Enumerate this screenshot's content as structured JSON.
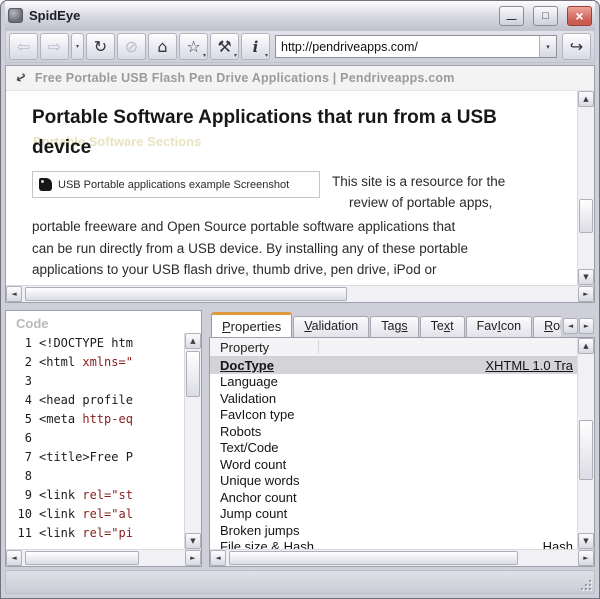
{
  "window": {
    "title": "SpidEye",
    "minimize_glyph": "—",
    "maximize_glyph": "□",
    "close_glyph": "×"
  },
  "toolbar": {
    "back_icon": "⇦",
    "forward_icon": "⇨",
    "history_dropdown_icon": "▾",
    "refresh_icon": "↻",
    "stop_icon": "⊘",
    "home_icon": "⌂",
    "favorites_icon": "☆",
    "tools_icon": "⚒",
    "info_icon": "i",
    "dropdown_icon": "▾",
    "url": "http://pendriveapps.com/",
    "go_icon": "↪"
  },
  "browser": {
    "page_cursor_icon": "↩",
    "page_title": "Free Portable USB Flash Pen Drive Applications | Pendriveapps.com",
    "heading": "Portable Software Applications that run from a USB device",
    "ghost_text": "Portable Software Sections",
    "image_alt": "USB Portable applications example Screenshot",
    "intro_line1": "This site is a resource for the",
    "intro_line2": "review of portable apps,",
    "body_lines": [
      "portable freeware and Open Source portable software applications that",
      "can be run directly from a USB device. By installing any of these portable",
      "applications to your USB flash drive, thumb drive, pen drive, iPod or"
    ]
  },
  "code": {
    "label": "Code",
    "lines": [
      {
        "n": "1",
        "a": "<!DOCTYPE htm",
        "b": ""
      },
      {
        "n": "2",
        "a": "<html ",
        "b": "xmlns=\""
      },
      {
        "n": "3",
        "a": "",
        "b": ""
      },
      {
        "n": "4",
        "a": "<head profile",
        "b": ""
      },
      {
        "n": "5",
        "a": "<meta ",
        "b": "http-eq"
      },
      {
        "n": "6",
        "a": "",
        "b": ""
      },
      {
        "n": "7",
        "a": "<title>Free P",
        "b": ""
      },
      {
        "n": "8",
        "a": "",
        "b": ""
      },
      {
        "n": "9",
        "a": "<link ",
        "b": "rel=\"st"
      },
      {
        "n": "10",
        "a": "<link ",
        "b": "rel=\"al"
      },
      {
        "n": "11",
        "a": "<link ",
        "b": "rel=\"pi"
      }
    ]
  },
  "props": {
    "tabs": [
      {
        "pre": "",
        "key": "P",
        "post": "roperties",
        "active": true
      },
      {
        "pre": "",
        "key": "V",
        "post": "alidation"
      },
      {
        "pre": "Tag",
        "key": "s",
        "post": ""
      },
      {
        "pre": "Te",
        "key": "x",
        "post": "t"
      },
      {
        "pre": "Fav",
        "key": "I",
        "post": "con"
      },
      {
        "pre": "",
        "key": "R",
        "post": "ol"
      }
    ],
    "header": "Property",
    "rows": [
      {
        "name": "DocType",
        "value": "XHTML 1.0 Tra",
        "selected": true
      },
      {
        "name": "Language",
        "value": ""
      },
      {
        "name": "Validation",
        "value": ""
      },
      {
        "name": "FavIcon type",
        "value": ""
      },
      {
        "name": "Robots",
        "value": ""
      },
      {
        "name": "Text/Code",
        "value": ""
      },
      {
        "name": "Word count",
        "value": ""
      },
      {
        "name": "Unique words",
        "value": ""
      },
      {
        "name": "Anchor count",
        "value": ""
      },
      {
        "name": "Jump count",
        "value": ""
      },
      {
        "name": "Broken jumps",
        "value": ""
      },
      {
        "name": "File size & Hash",
        "value": "Hash"
      }
    ]
  },
  "glyphs": {
    "up": "▲",
    "down": "▼",
    "left": "◄",
    "right": "►",
    "tab_prev": "◄",
    "tab_next": "►"
  },
  "colors": {
    "tab_accent": "#e09a3e",
    "close_button": "#cb5a50",
    "code_attribute": "#8b1d1d",
    "chrome_silver": "#cfcfda"
  }
}
